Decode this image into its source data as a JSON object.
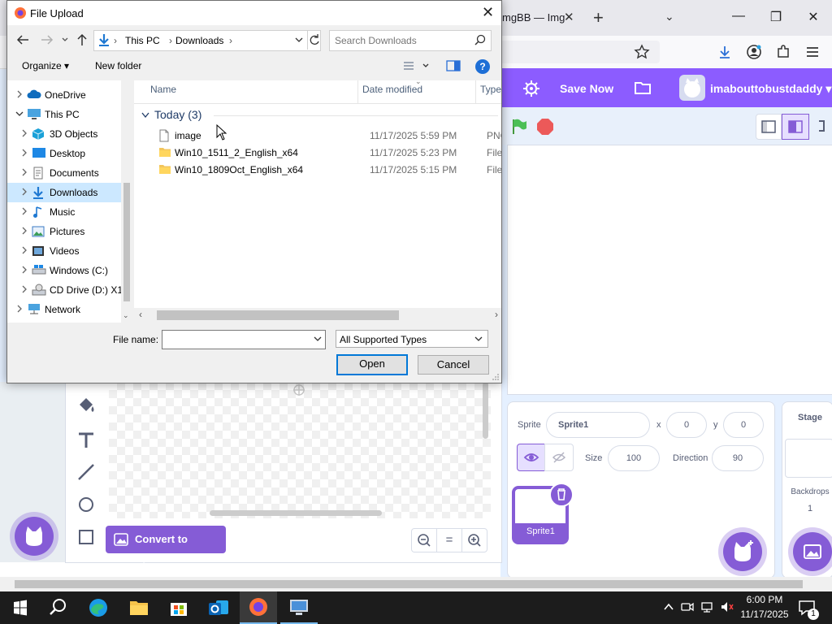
{
  "browser": {
    "tab_title": "ImgBB — ImgBB",
    "tab_title_visible": "mgBB — Img",
    "new_tab_symbol": "+",
    "close_tab_symbol": "✕",
    "list_tabs_symbol": "⌄"
  },
  "scratch": {
    "save_now": "Save Now",
    "username": "imabouttobustdaddy",
    "sprite_label": "Sprite",
    "sprite_name": "Sprite1",
    "x_label": "x",
    "x_value": "0",
    "y_label": "y",
    "y_value": "0",
    "size_label": "Size",
    "size_value": "100",
    "direction_label": "Direction",
    "direction_value": "90",
    "sprite_tile_label": "Sprite1",
    "stage_label": "Stage",
    "backdrops_label": "Backdrops",
    "backdrops_count": "1",
    "convert_label": "Convert to Bitmap",
    "zoom_out": "−",
    "zoom_reset": "=",
    "zoom_in": "+",
    "tools": [
      "fill-icon",
      "text-icon",
      "line-icon",
      "circle-icon",
      "rectangle-icon"
    ]
  },
  "dialog": {
    "title": "File Upload",
    "breadcrumb": [
      "This PC",
      "Downloads"
    ],
    "search_placeholder": "Search Downloads",
    "organize_label": "Organize ▾",
    "new_folder_label": "New folder",
    "tree": [
      {
        "label": "OneDrive",
        "icon": "cloud-icon",
        "level": 0,
        "expanded": false,
        "selected": false
      },
      {
        "label": "This PC",
        "icon": "pc-icon",
        "level": 0,
        "expanded": true,
        "selected": false
      },
      {
        "label": "3D Objects",
        "icon": "cube-icon",
        "level": 1,
        "expanded": false,
        "selected": false
      },
      {
        "label": "Desktop",
        "icon": "desktop-icon",
        "level": 1,
        "expanded": false,
        "selected": false
      },
      {
        "label": "Documents",
        "icon": "documents-icon",
        "level": 1,
        "expanded": false,
        "selected": false
      },
      {
        "label": "Downloads",
        "icon": "download-arrow-icon",
        "level": 1,
        "expanded": false,
        "selected": true
      },
      {
        "label": "Music",
        "icon": "music-icon",
        "level": 1,
        "expanded": false,
        "selected": false
      },
      {
        "label": "Pictures",
        "icon": "pictures-icon",
        "level": 1,
        "expanded": false,
        "selected": false
      },
      {
        "label": "Videos",
        "icon": "videos-icon",
        "level": 1,
        "expanded": false,
        "selected": false
      },
      {
        "label": "Windows (C:)",
        "icon": "drive-icon",
        "level": 1,
        "expanded": false,
        "selected": false
      },
      {
        "label": "CD Drive (D:) X1",
        "icon": "cd-drive-icon",
        "level": 1,
        "expanded": false,
        "selected": false
      },
      {
        "label": "Network",
        "icon": "network-icon",
        "level": 0,
        "expanded": false,
        "selected": false
      }
    ],
    "columns": [
      "Name",
      "Date modified",
      "Type"
    ],
    "group_label": "Today (3)",
    "files": [
      {
        "name": "image",
        "date": "11/17/2025 5:59 PM",
        "type": "PNG",
        "icon": "file-icon"
      },
      {
        "name": "Win10_1511_2_English_x64",
        "date": "11/17/2025 5:23 PM",
        "type": "File fo",
        "icon": "folder-icon"
      },
      {
        "name": "Win10_1809Oct_English_x64",
        "date": "11/17/2025 5:15 PM",
        "type": "File fo",
        "icon": "folder-icon"
      }
    ],
    "file_name_label": "File name:",
    "file_name_value": "",
    "file_type_value": "All Supported Types",
    "open_label": "Open",
    "cancel_label": "Cancel"
  },
  "taskbar": {
    "time": "6:00 PM",
    "date": "11/17/2025",
    "notification_count": "1"
  },
  "colors": {
    "scratch_purple": "#855cd6",
    "scratch_menu": "#8c5cff",
    "selection_blue": "#cce8ff",
    "accent_blue": "#0078d7"
  }
}
